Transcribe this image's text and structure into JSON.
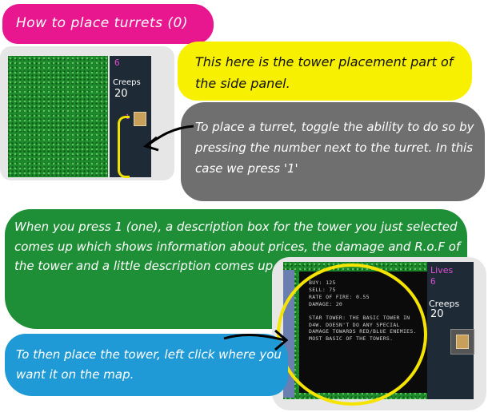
{
  "title": "How to place turrets (0)",
  "small_panel": {
    "top_number": "6",
    "creeps_label": "Creeps",
    "creeps_value": "20",
    "turret_hotkey": "1"
  },
  "notes": {
    "yellow": "This here is the tower placement part of the side panel.",
    "grey": "To place a turret, toggle the ability to do so by pressing the number next to the turret. In this case we press '1'",
    "green": "When you press 1 (one), a description box for the tower you just selected comes up which shows information about prices, the damage and R.o.F of the tower and a little description comes up.",
    "blue": "To then place the tower, left click where you want it on the map."
  },
  "big_panel": {
    "lives_label": "Lives",
    "lives_value": "6",
    "creeps_label": "Creeps",
    "creeps_value": "20",
    "info": {
      "buy": "BUY: 125",
      "sell": "SELL: 75",
      "rate": "RATE OF FIRE: 0.55",
      "damage": "DAMAGE: 20",
      "description": "STAR TOWER: THE BASIC TOWER IN D4W. DOESN'T DO ANY SPECIAL DAMAGE TOWARDS RED/BLUE ENEMIES. MOST BASIC OF THE TOWERS."
    }
  },
  "colors": {
    "pink": "#e8168f",
    "yellow": "#f7f000",
    "grey": "#6f6f6f",
    "green": "#1f8f37",
    "blue": "#1f9ad6",
    "grass": "#1d8a2b",
    "panel": "#1e2a35"
  }
}
